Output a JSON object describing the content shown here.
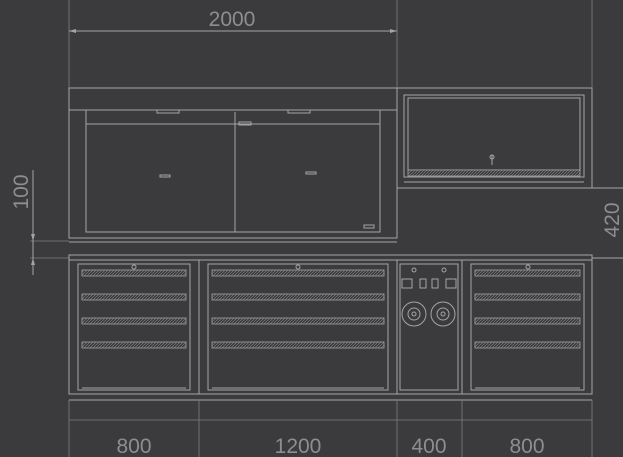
{
  "drawing": {
    "dimensions": {
      "overall_width": "2000",
      "left_height": "100",
      "right_height": "420",
      "module_1": "800",
      "module_2": "1200",
      "module_3": "400",
      "module_4": "800"
    },
    "colors": {
      "background": "#3b3b3d",
      "line": "#a4a4a8",
      "text": "#8e8e92"
    }
  }
}
